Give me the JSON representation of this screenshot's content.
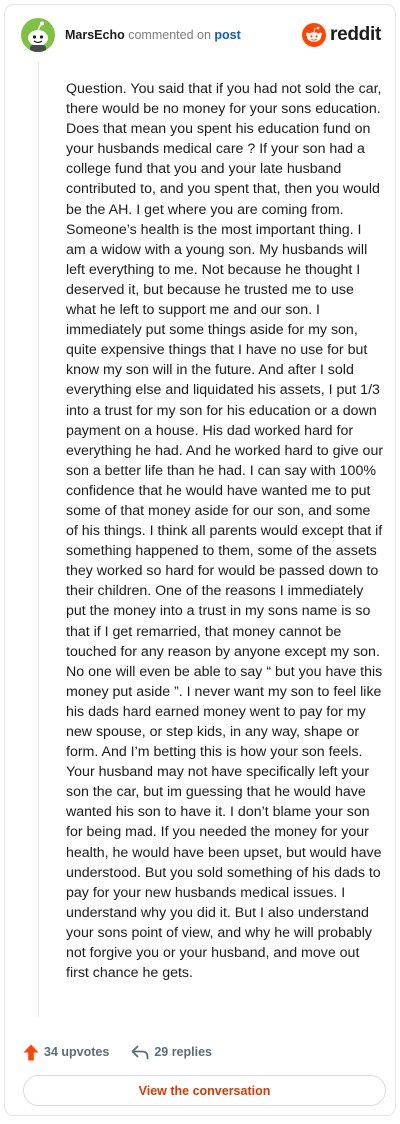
{
  "header": {
    "username": "MarsEcho",
    "action_text": "commented on",
    "target_link": "post",
    "brand": "reddit",
    "avatar_icon": "snoo-avatar-icon",
    "brand_icon": "reddit-logo-icon"
  },
  "comment": {
    "text": "Question. You said that if you had not sold the car, there would be no money for your sons education. Does that mean you spent his education fund on your husbands medical care ? If your son had a college fund that you and your late husband contributed to, and you spent that, then you would be the AH. I get where you are coming from. Someone’s health is the most important thing. I am a widow with a young son. My husbands will left everything to me. Not because he thought I deserved it, but because he trusted me to use what he left to support me and our son. I immediately put some things aside for my son, quite expensive things that I have no use for but know my son will in the future. And after I sold everything else and liquidated his assets, I put 1/3 into a trust for my son for his education or a down payment on a house. His dad worked hard for everything he had. And he worked hard to give our son a better life than he had. I can say with 100% confidence that he would have wanted me to put some of that money aside for our son, and some of his things. I think all parents would except that if something happened to them, some of the assets they worked so hard for would be passed down to their children. One of the reasons I immediately put the money into a trust in my sons name is so that if I get remarried, that money cannot be touched for any reason by anyone except my son. No one will even be able to say “ but you have this money put aside ”. I never want my son to feel like his dads hard earned money went to pay for my new spouse, or step kids, in any way, shape or form. And I’m betting this is how your son feels. Your husband may not have specifically left your son the car, but im guessing that he would have wanted his son to have it. I don’t blame your son for being mad. If you needed the money for your health, he would have been upset, but would have understood. But you sold something of his dads to pay for your new husbands medical issues. I understand why you did it. But I also understand your sons point of view, and why he will probably not forgive you or your husband, and move out first chance he gets."
  },
  "actions": {
    "upvotes": "34 upvotes",
    "replies": "29 replies",
    "upvote_icon": "upvote-arrow-icon",
    "reply_icon": "reply-arrow-icon"
  },
  "cta": {
    "label": "View the conversation"
  },
  "colors": {
    "accent": "#ff4500",
    "link": "#0b5fbf",
    "cta_text": "#d93a00",
    "avatar_bg": "#7dc242"
  }
}
